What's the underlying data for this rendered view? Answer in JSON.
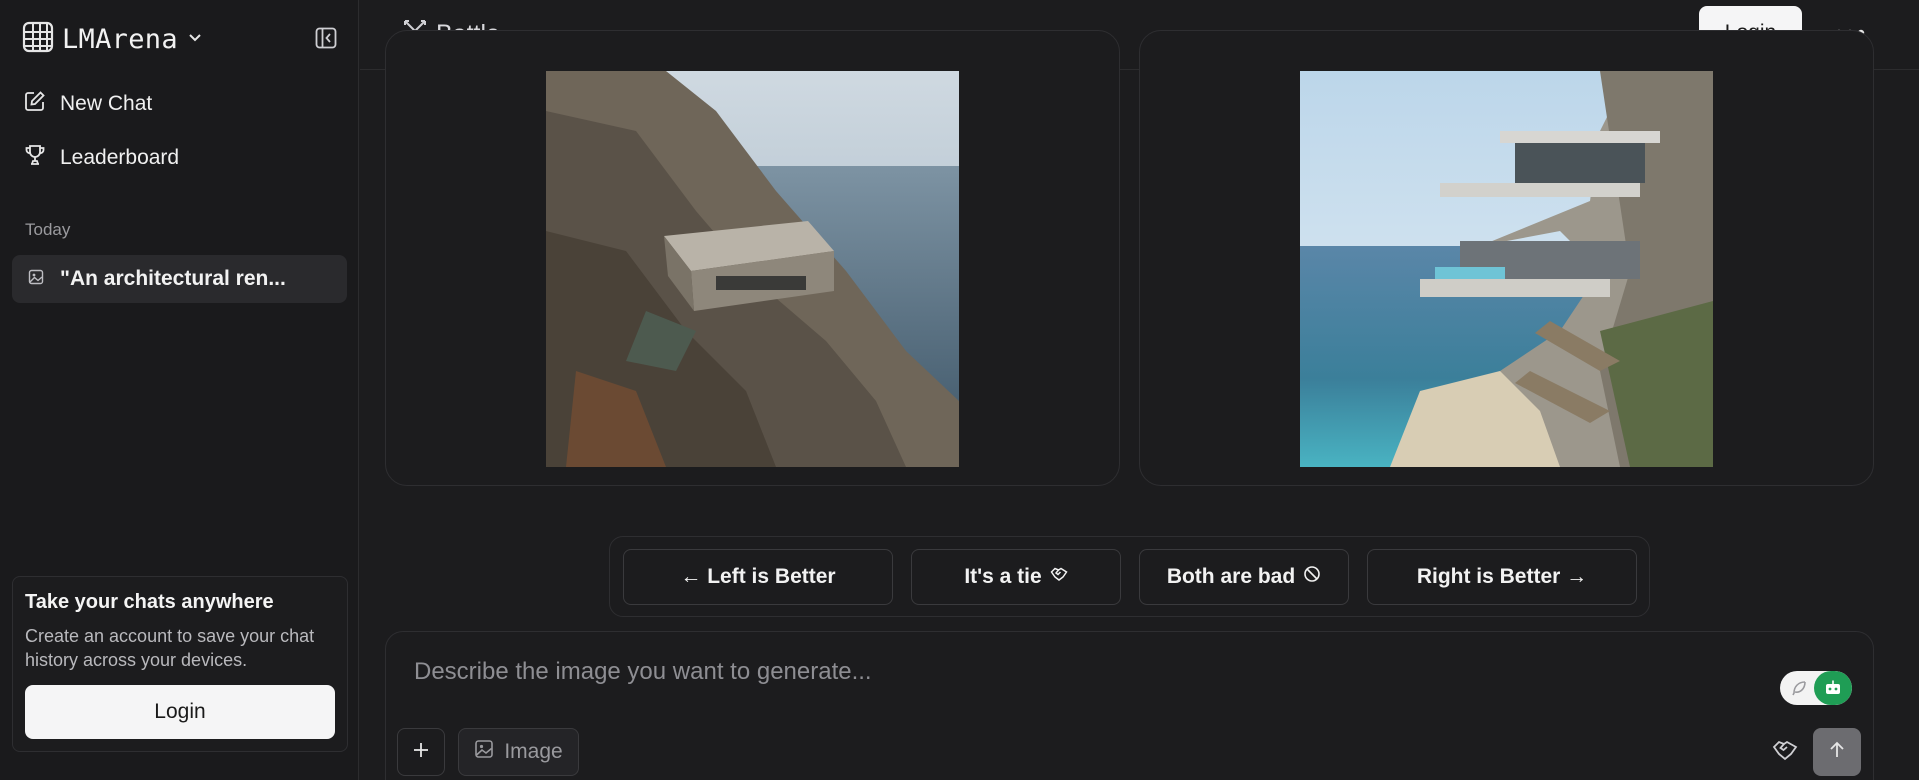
{
  "sidebar": {
    "brand": "LMArena",
    "new_chat": "New Chat",
    "leaderboard": "Leaderboard",
    "section_today": "Today",
    "history_item": "\"An architectural ren...",
    "promo": {
      "title": "Take your chats anywhere",
      "text": "Create an account to save your chat history across your devices.",
      "login": "Login"
    }
  },
  "topbar": {
    "mode": "Battle",
    "login": "Login"
  },
  "vote": {
    "left": "← Left is Better",
    "tie": "It's a tie",
    "bad": "Both are bad",
    "right": "Right is Better →"
  },
  "composer": {
    "placeholder": "Describe the image you want to generate...",
    "image_label": "Image"
  },
  "icons": {
    "brand": "grid-icon",
    "collapse": "sidebar-collapse-icon",
    "new_chat": "edit-icon",
    "leaderboard": "trophy-icon",
    "history": "image-icon",
    "battle": "swords-icon",
    "more": "ellipsis-icon",
    "tie": "handshake-icon",
    "bad": "ban-icon",
    "plus": "plus-icon",
    "image": "image-icon",
    "send": "arrow-up-icon"
  },
  "colors": {
    "background": "#1c1c1e",
    "toggle_on": "#1f9d55",
    "send": "#6c6c70"
  }
}
